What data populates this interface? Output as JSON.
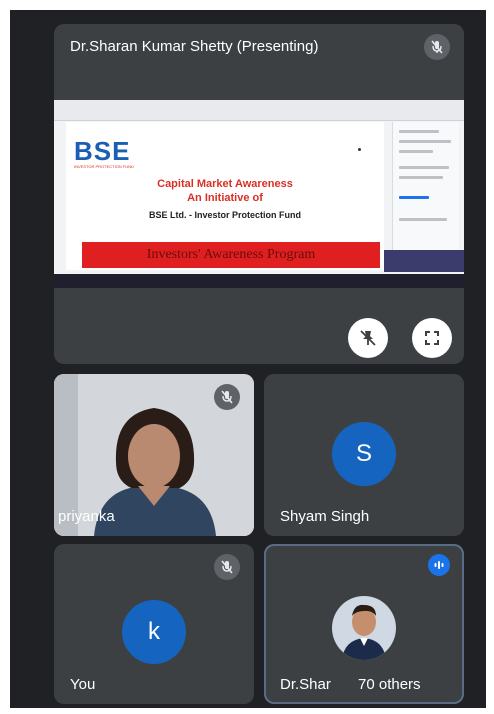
{
  "presenter_tile": {
    "name": "Dr.Sharan Kumar Shetty (Presenting)",
    "slide": {
      "logo": "BSE",
      "logo_sub": "INVESTOR PROTECTION FUND",
      "line1": "Capital Market Awareness",
      "line2": "An Initiative of",
      "line3": "BSE Ltd.  - Investor Protection Fund",
      "banner": "Investors' Awareness Program"
    },
    "buttons": {
      "pin": "pin-off-icon",
      "fullscreen": "fullscreen-icon"
    }
  },
  "participants": [
    {
      "name": "priyanka",
      "muted": true
    },
    {
      "name": "Shyam Singh",
      "initial": "S",
      "avatar_color": "#1565c0"
    },
    {
      "name": "You",
      "initial": "k",
      "avatar_color": "#1565c0",
      "muted": true
    },
    {
      "name": "Dr.Shar",
      "speaking": true,
      "others_label": "70 others"
    }
  ],
  "colors": {
    "background": "#202124",
    "tile": "#3c4043",
    "accent": "#1a73e8",
    "avatar": "#1565c0"
  }
}
